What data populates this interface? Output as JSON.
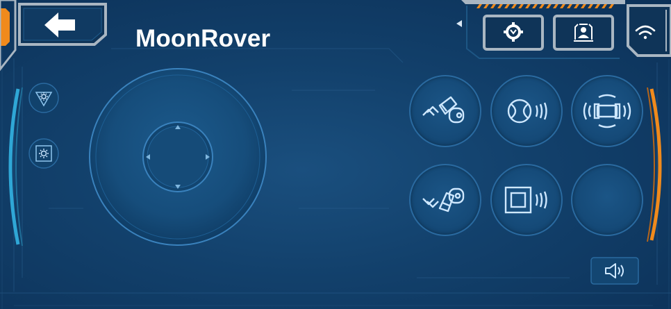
{
  "app": {
    "title": "MoonRover"
  },
  "icons": {
    "back": "back-arrow-icon",
    "settings": "settings-gear-icon",
    "help": "person-help-icon",
    "wifi": "wifi-icon",
    "brightness_down": "brightness-down-icon",
    "brightness_up": "brightness-up-icon",
    "arm_up": "arm-up-icon",
    "ball": "ball-vibration-icon",
    "vibrate": "vibrate-icon",
    "arm_down": "arm-down-icon",
    "square": "square-vibration-icon",
    "volume": "speaker-icon"
  },
  "colors": {
    "background": "#12406b",
    "accent_orange": "#f08a1c",
    "accent_cyan": "#2fa7d6",
    "button_border": "#2a6aa0",
    "icon": "#cfe8ff"
  }
}
